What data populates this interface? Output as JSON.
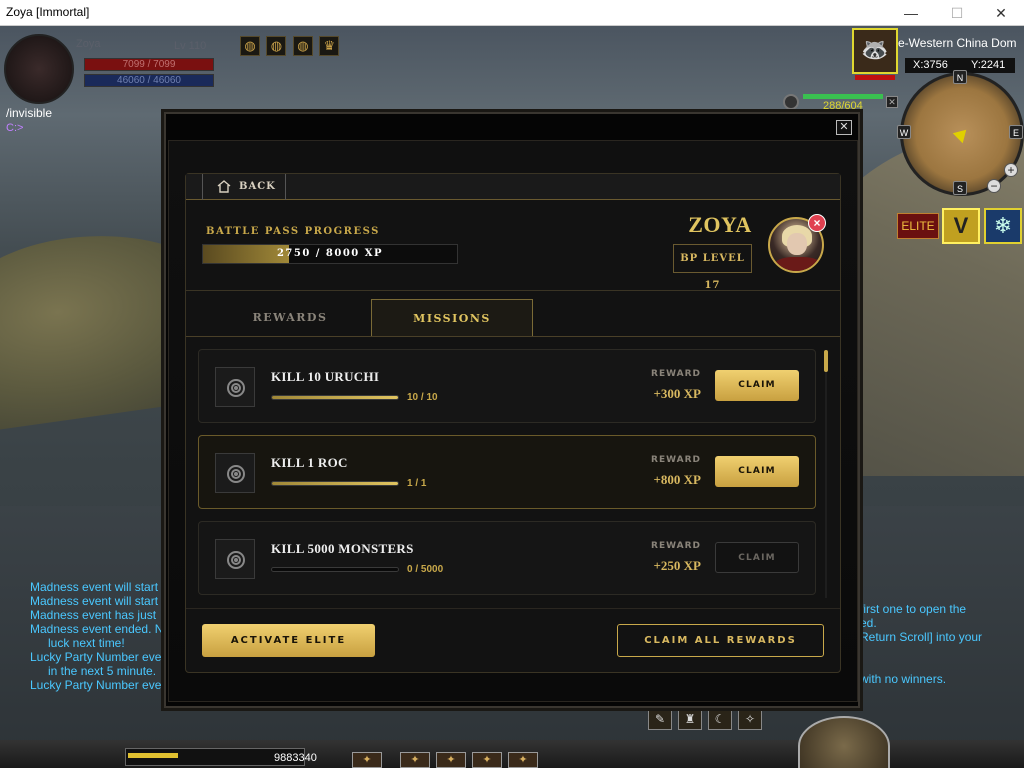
{
  "window": {
    "title": "Zoya [Immortal]",
    "minimize": "—",
    "maximize": "☐",
    "close": "✕"
  },
  "player": {
    "name": "Zoya",
    "level": "Lv 110",
    "hp": "7099 / 7099",
    "mp": "46060 / 46060"
  },
  "buffs": [
    "◍",
    "◍",
    "◍",
    "♛"
  ],
  "chat_input": {
    "command": "/invisible",
    "prompt": "C:>"
  },
  "zone": {
    "name": "e-Western China Dom",
    "x": "X:3756",
    "y": "Y:2241"
  },
  "compass": {
    "n": "N",
    "s": "S",
    "e": "E",
    "w": "W"
  },
  "target": {
    "hp_text": "288/604"
  },
  "hud_icons": {
    "elite": "ELITE",
    "vip": "V",
    "snow": "❄"
  },
  "chat_log": [
    "Madness event will start",
    "Madness event will start",
    "Madness event has just",
    "Madness event ended. N",
    "luck next time!",
    "Lucky Party Number eve",
    "in the next 5 minute.",
    "Lucky Party Number eve"
  ],
  "chat_right": [
    "first one to open the",
    "ed.",
    "Return Scroll] into your",
    "",
    "",
    "with no winners."
  ],
  "hud": {
    "gold": "9883340"
  },
  "modal": {
    "close": "✕",
    "back_label": "BACK",
    "bp_progress_label": "BATTLE PASS PROGRESS",
    "bp_progress_text": "2750 / 8000 XP",
    "bp_progress_fraction": 0.34,
    "player_name": "ZOYA",
    "bp_level": "BP LEVEL 17",
    "avatar_close": "×",
    "tabs": {
      "rewards": "REWARDS",
      "missions": "MISSIONS",
      "active": "missions"
    },
    "missions": [
      {
        "title": "KILL 10 URUCHI",
        "progress": "10 / 10",
        "fraction": 1.0,
        "reward_label": "REWARD",
        "reward": "+300 XP",
        "claim": "CLAIM",
        "claimable": true
      },
      {
        "title": "KILL 1 ROC",
        "progress": "1 / 1",
        "fraction": 1.0,
        "reward_label": "REWARD",
        "reward": "+800 XP",
        "claim": "CLAIM",
        "claimable": true
      },
      {
        "title": "KILL 5000 MONSTERS",
        "progress": "0 / 5000",
        "fraction": 0.0,
        "reward_label": "REWARD",
        "reward": "+250 XP",
        "claim": "CLAIM",
        "claimable": false
      }
    ],
    "activate_elite": "ACTIVATE ELITE",
    "claim_all": "CLAIM ALL REWARDS"
  }
}
